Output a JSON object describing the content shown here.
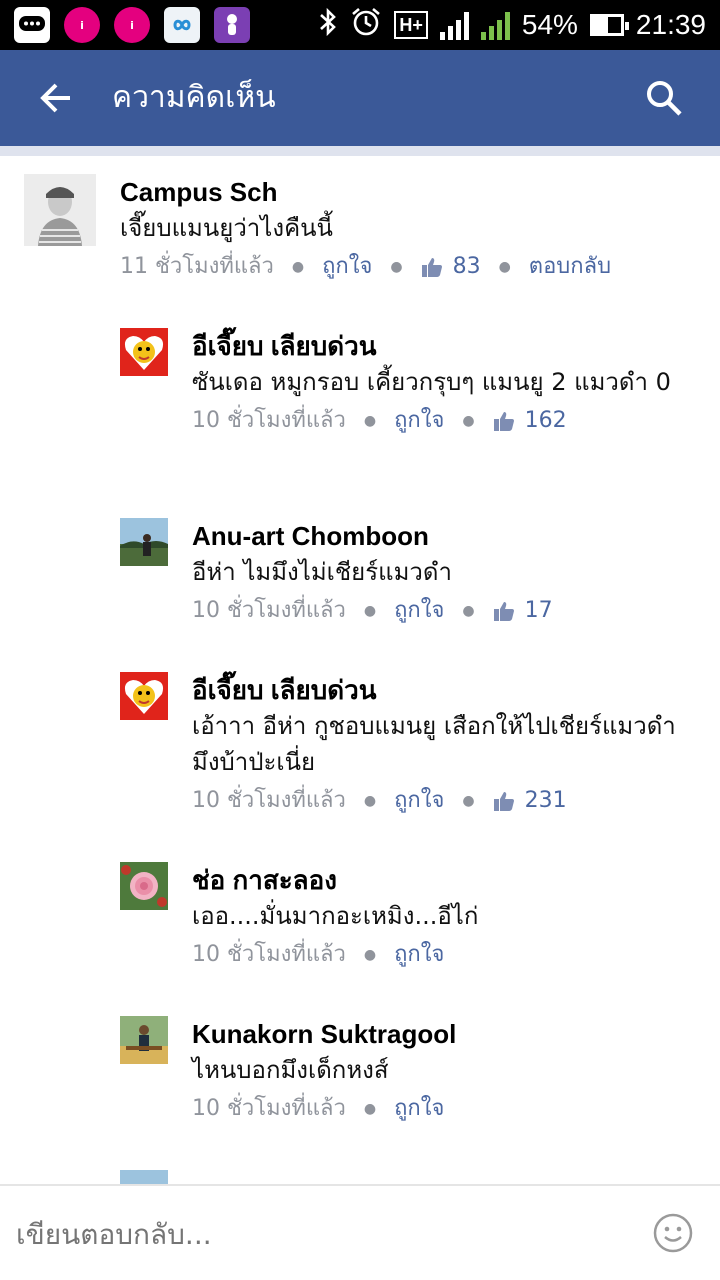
{
  "status_bar": {
    "apps": [
      {
        "icon": "chat-bubble-icon",
        "color": "#ffffff"
      },
      {
        "icon": "ishow-icon",
        "color": "#e4007f"
      },
      {
        "icon": "ishow-icon",
        "color": "#e4007f"
      },
      {
        "icon": "infinity-icon",
        "color": "#ffffff"
      },
      {
        "icon": "skyboo-icon",
        "color": "#7b3fb3"
      }
    ],
    "network": "H+",
    "sim1": "1",
    "sim2": "2",
    "battery": "54%",
    "time": "21:39"
  },
  "header": {
    "title": "ความคิดเห็น",
    "color": "#3b5998"
  },
  "comments": [
    {
      "name": "Campus Sch",
      "text": "เจี๊ยบแมนยูว่าไงคืนนี้",
      "time": "11 ชั่วโมงที่แล้ว",
      "like_label": "ถูกใจ",
      "likes": "83",
      "reply_label": "ตอบกลับ"
    },
    {
      "name": "อีเจี๊ยบ เลียบด่วน",
      "text": "ซันเดอ หมูกรอบ เคี้ยวกรุบๆ แมนยู 2 แมวดำ 0",
      "time": "10 ชั่วโมงที่แล้ว",
      "like_label": "ถูกใจ",
      "likes": "162"
    },
    {
      "name": "Anu-art Chomboon",
      "text": "อีห่า ไมมึงไม่เชียร์แมวดำ",
      "time": "10 ชั่วโมงที่แล้ว",
      "like_label": "ถูกใจ",
      "likes": "17"
    },
    {
      "name": "อีเจี๊ยบ เลียบด่วน",
      "text": "เอ้าาา อีห่า กูชอบแมนยู เสือกให้ไปเชียร์แมวดำ มึงบ้าป่ะเนี่ย",
      "time": "10 ชั่วโมงที่แล้ว",
      "like_label": "ถูกใจ",
      "likes": "231"
    },
    {
      "name": "ช่อ กาสะลอง",
      "text": "เออ....มั่นมากอะเหมิง...อีไก่",
      "time": "10 ชั่วโมงที่แล้ว",
      "like_label": "ถูกใจ"
    },
    {
      "name": "Kunakorn Suktragool",
      "text": "ไหนบอกมึงเด็กหงส์",
      "time": "10 ชั่วโมงที่แล้ว",
      "like_label": "ถูกใจ"
    }
  ],
  "composer": {
    "placeholder": "เขียนตอบกลับ..."
  }
}
